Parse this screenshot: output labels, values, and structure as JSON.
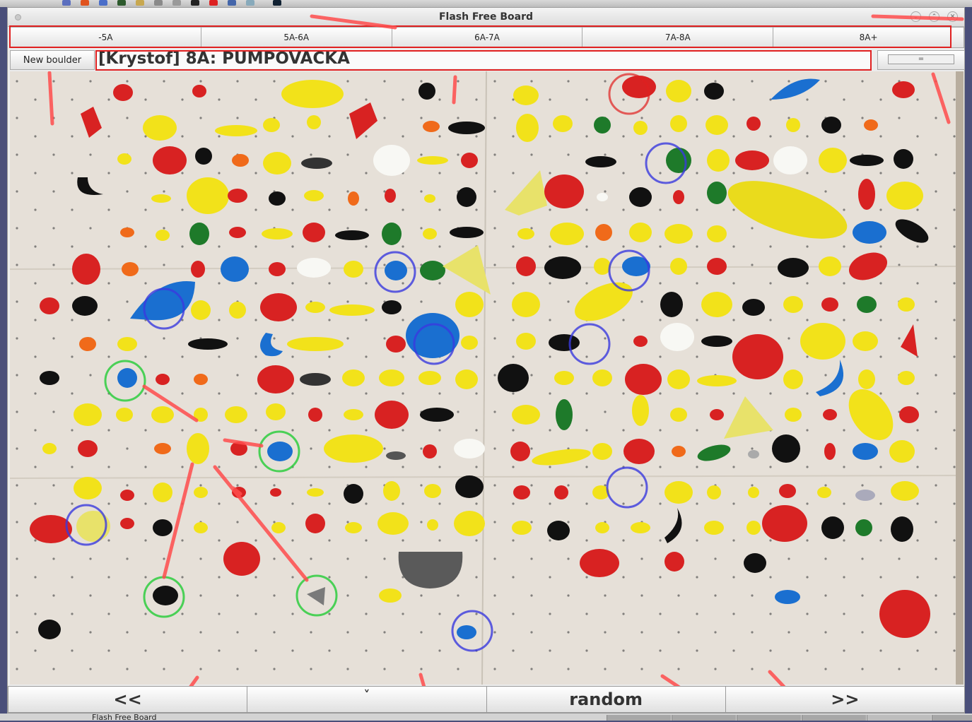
{
  "window": {
    "title": "Flash Free Board"
  },
  "grade_filters": [
    "-5A",
    "5A-6A",
    "6A-7A",
    "7A-8A",
    "8A+"
  ],
  "toolbar": {
    "new_boulder_label": "New boulder",
    "boulder_name": "[Krystof] 8A: PUMPOVACKA",
    "menu_label": "="
  },
  "navigation": {
    "prev_label": "<<",
    "down_label": "˅",
    "random_label": "random",
    "next_label": ">>"
  },
  "taskbar": {
    "item_label": "Flash Free Board"
  },
  "colors": {
    "start_hold_marker": "#2ecc40",
    "top_hold_marker": "#e02020",
    "hand_hold_marker": "#3a3adf",
    "annotation": "#ff4d4d"
  }
}
